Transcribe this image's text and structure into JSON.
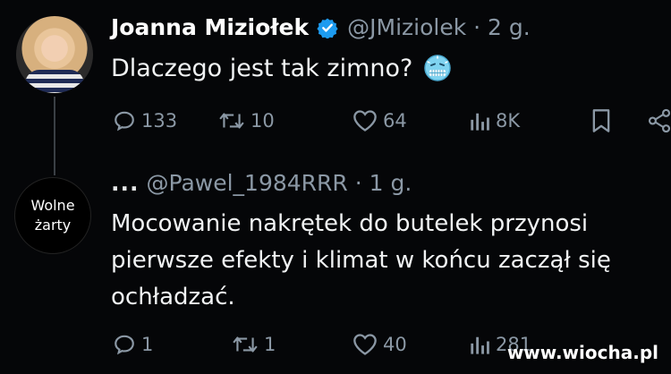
{
  "tweet": {
    "author_name": "Joanna Miziołek",
    "handle_time": "@JMiziolek · 2 g.",
    "text": "Dlaczego jest tak zimno?",
    "emoji_icon": "cold-face-emoji",
    "replies": "133",
    "retweets": "10",
    "likes": "64",
    "views": "8K"
  },
  "reply": {
    "avatar_line1": "Wolne",
    "avatar_line2": "żarty",
    "dots": "...",
    "handle_time": "@Pawel_1984RRR · 1 g.",
    "text": "Mocowanie nakrętek do butelek przynosi pierwsze efekty i klimat w końcu zaczął się ochładzać.",
    "replies": "1",
    "retweets": "1",
    "likes": "40",
    "views": "281"
  },
  "watermark": "www.wiocha.pl",
  "colors": {
    "background": "#050608",
    "text": "#e7e9ea",
    "muted": "#8b98a5",
    "verified": "#1d9bf0"
  }
}
